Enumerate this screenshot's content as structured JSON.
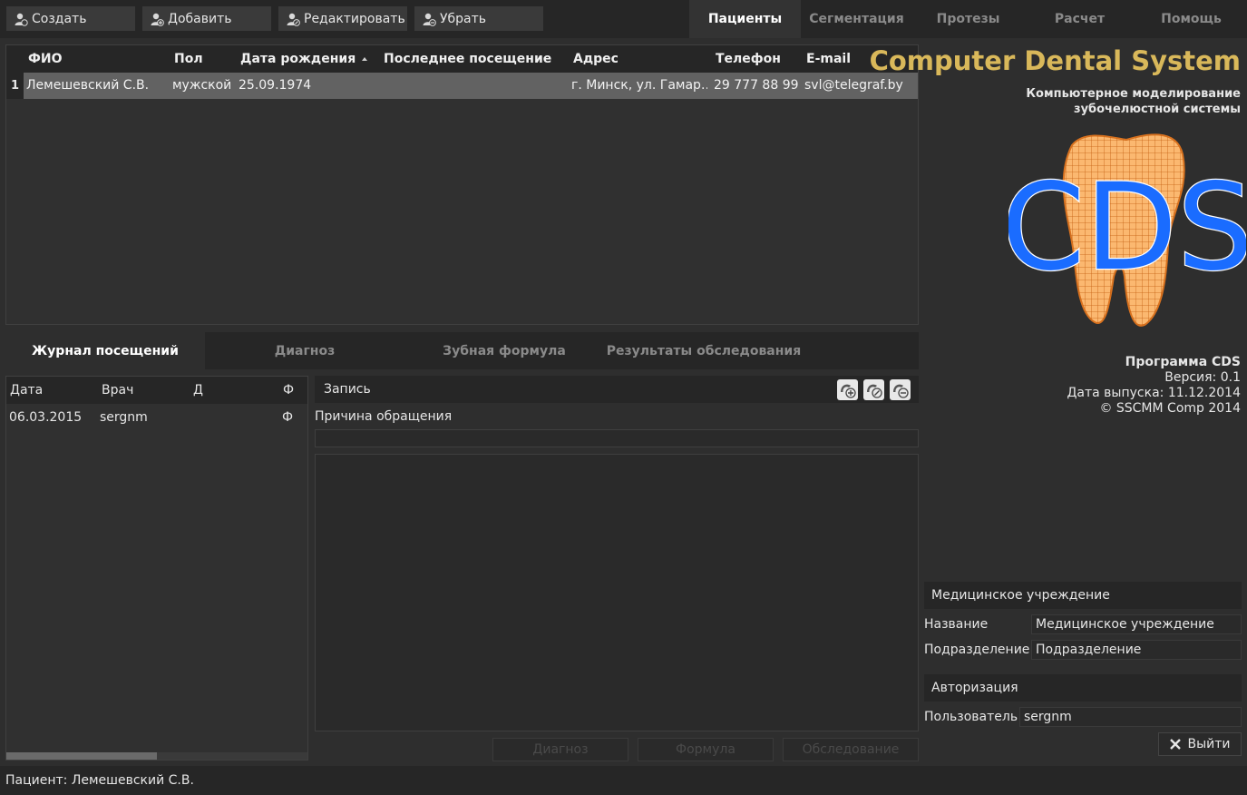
{
  "toolbar": {
    "create": "Создать",
    "add": "Добавить",
    "edit": "Редактировать",
    "remove": "Убрать"
  },
  "main_tabs": [
    "Пациенты",
    "Сегментация",
    "Протезы",
    "Расчет",
    "Помощь"
  ],
  "patients": {
    "headers": [
      "ФИО",
      "Пол",
      "Дата рождения",
      "Последнее посещение",
      "Адрес",
      "Телефон",
      "E-mail"
    ],
    "rows": [
      {
        "num": "1",
        "name": "Лемешевский С.В.",
        "sex": "мужской",
        "birth": "25.09.1974",
        "last_visit": "",
        "address": "г. Минск, ул. Гамар…",
        "phone": "29 777 88 99",
        "email": "svl@telegraf.by"
      }
    ]
  },
  "sub_tabs": [
    "Журнал посещений",
    "Диагноз",
    "Зубная формула",
    "Результаты обследования"
  ],
  "visits": {
    "headers": [
      "Дата",
      "Врач",
      "Д",
      "Ф"
    ],
    "rows": [
      {
        "date": "06.03.2015",
        "doctor": "sergnm",
        "d": "",
        "f": "Ф"
      }
    ]
  },
  "record": {
    "title": "Запись",
    "reason_label": "Причина обращения",
    "reason_value": "",
    "notes_value": ""
  },
  "bottom_buttons": [
    "Диагноз",
    "Формула",
    "Обследование"
  ],
  "brand": {
    "title": "Computer Dental System",
    "subtitle_line1": "Компьютерное моделирование",
    "subtitle_line2": "зубочелюстной системы",
    "logo_text": "CDS"
  },
  "about": {
    "program": "Программа CDS",
    "version": "Версия: 0.1",
    "release": "Дата выпуска: 11.12.2014",
    "copyright": "© SSCMM Comp 2014"
  },
  "institution": {
    "header": "Медицинское учреждение",
    "name_label": "Название",
    "name_value": "Медицинское учреждение",
    "dept_label": "Подразделение",
    "dept_value": "Подразделение"
  },
  "auth": {
    "header": "Авторизация",
    "user_label": "Пользователь",
    "user_value": "sergnm",
    "logout": "Выйти"
  },
  "status": {
    "text": "Пациент: Лемешевский С.В."
  },
  "colors": {
    "brand": "#d9b85a",
    "logo_blue": "#1a6cff",
    "tooth_orange": "#f29a3c",
    "selection": "#626262"
  },
  "icons": {
    "toolbar": "user-icon",
    "sort": "sort-asc-icon",
    "record_add": "add-icon",
    "record_edit": "edit-icon",
    "record_remove": "remove-icon",
    "logout": "close-icon"
  }
}
